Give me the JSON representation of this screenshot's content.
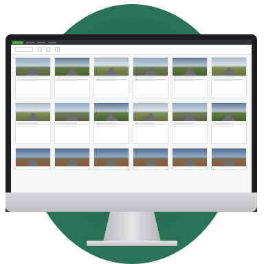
{
  "colors": {
    "background_circle": "#2a7358",
    "monitor_bezel": "#1d1e20",
    "brand_accent": "#3fae49",
    "screen_bg": "#f4f5f6"
  },
  "app": {
    "topbar_nav_items": [
      "nav-item",
      "nav-item",
      "nav-item"
    ]
  },
  "toolbar": {
    "filter_label": "",
    "sort_label": ""
  },
  "grid": {
    "rows": 3,
    "columns": 6
  }
}
